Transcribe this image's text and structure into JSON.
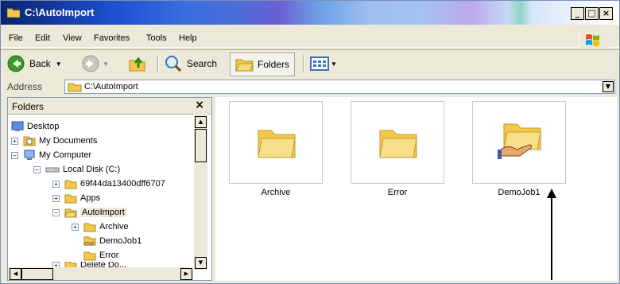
{
  "window": {
    "title": "C:\\AutoImport"
  },
  "menu": [
    "File",
    "Edit",
    "View",
    "Favorites",
    "Tools",
    "Help"
  ],
  "toolbar": {
    "back": "Back",
    "search": "Search",
    "folders": "Folders"
  },
  "address": {
    "label": "Address",
    "value": "C:\\AutoImport"
  },
  "folders_pane": {
    "title": "Folders",
    "close": "×",
    "tree": [
      {
        "label": "Desktop",
        "icon": "desktop-icon"
      },
      {
        "label": "My Documents",
        "icon": "my-documents-icon",
        "expander": "+"
      },
      {
        "label": "My Computer",
        "icon": "my-computer-icon",
        "expander": "−"
      },
      {
        "label": "Local Disk (C:)",
        "icon": "drive-icon",
        "expander": "−"
      },
      {
        "label": "69f44da13400dff6707",
        "icon": "folder-icon",
        "expander": "+"
      },
      {
        "label": "Apps",
        "icon": "folder-icon",
        "expander": "+"
      },
      {
        "label": "AutoImport",
        "icon": "folder-open-icon",
        "expander": "−",
        "selected": true
      },
      {
        "label": "Archive",
        "icon": "folder-icon",
        "expander": "+"
      },
      {
        "label": "DemoJob1",
        "icon": "shared-folder-icon"
      },
      {
        "label": "Error",
        "icon": "folder-icon"
      },
      {
        "label": "Delete Do...",
        "icon": "folder-icon",
        "expander": "+"
      }
    ]
  },
  "items": [
    {
      "label": "Archive",
      "icon": "folder-icon"
    },
    {
      "label": "Error",
      "icon": "folder-icon"
    },
    {
      "label": "DemoJob1",
      "icon": "shared-folder-icon"
    }
  ]
}
